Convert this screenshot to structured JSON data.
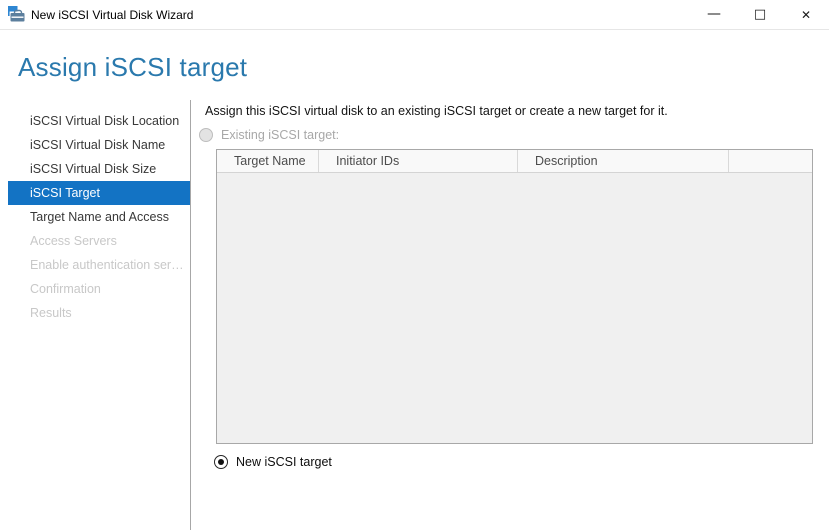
{
  "window": {
    "title": "New iSCSI Virtual Disk Wizard",
    "controls": {
      "minimize": "—",
      "maximize": "□",
      "close": "✕"
    }
  },
  "page": {
    "title": "Assign iSCSI target"
  },
  "sidebar": {
    "items": [
      {
        "label": "iSCSI Virtual Disk Location",
        "state": "enabled"
      },
      {
        "label": "iSCSI Virtual Disk Name",
        "state": "enabled"
      },
      {
        "label": "iSCSI Virtual Disk Size",
        "state": "enabled"
      },
      {
        "label": "iSCSI Target",
        "state": "current"
      },
      {
        "label": "Target Name and Access",
        "state": "enabled"
      },
      {
        "label": "Access Servers",
        "state": "disabled"
      },
      {
        "label": "Enable authentication ser…",
        "state": "disabled"
      },
      {
        "label": "Confirmation",
        "state": "disabled"
      },
      {
        "label": "Results",
        "state": "disabled"
      }
    ]
  },
  "main": {
    "intro": "Assign this iSCSI virtual disk to an existing iSCSI target or create a new target for it.",
    "existing_option": {
      "label": "Existing iSCSI target:",
      "selected": false,
      "enabled": false
    },
    "new_option": {
      "label": "New iSCSI target",
      "selected": true,
      "enabled": true
    },
    "table": {
      "columns": [
        "Target Name",
        "Initiator IDs",
        "Description",
        ""
      ],
      "rows": []
    }
  },
  "colors": {
    "heading": "#2a79ad",
    "selected_step_bg": "#1373c4",
    "selected_step_text": "#ffffff",
    "disabled_text": "#c8c8c8",
    "table_bg": "#f0f0f0",
    "table_border": "#a8a8a8"
  }
}
